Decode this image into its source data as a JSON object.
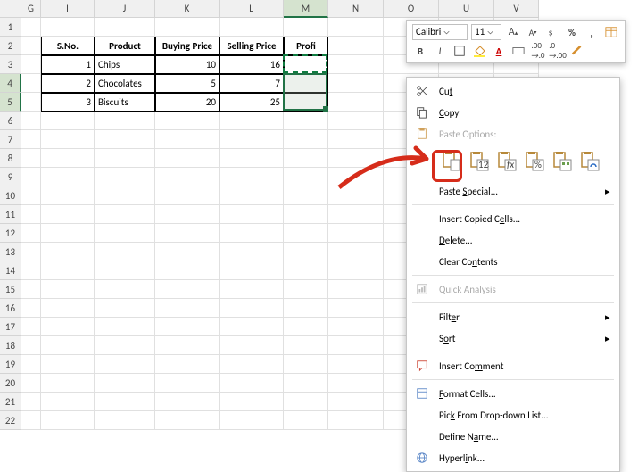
{
  "columns": [
    "G",
    "I",
    "J",
    "K",
    "L",
    "M",
    "N",
    "O",
    "U",
    "V"
  ],
  "sel_cols": [
    "M"
  ],
  "sel_rows": [
    4,
    5
  ],
  "row_count": 22,
  "table": {
    "headers": {
      "sno": "S.No.",
      "product": "Product",
      "bp": "Buying Price",
      "sp": "Selling Price",
      "profit": "Profi"
    },
    "rows": [
      {
        "sno": "1",
        "product": "Chips",
        "bp": "10",
        "sp": "16"
      },
      {
        "sno": "2",
        "product": "Chocolates",
        "bp": "5",
        "sp": "7"
      },
      {
        "sno": "3",
        "product": "Biscuits",
        "bp": "20",
        "sp": "25"
      }
    ]
  },
  "mini": {
    "font": "Calibri",
    "size": "11",
    "bold": "B",
    "italic": "I"
  },
  "ctx": {
    "cut": "Cut",
    "copy": "Copy",
    "paste_hdr": "Paste Options:",
    "paste_special": "Paste Special...",
    "insert": "Insert Copied Cells...",
    "delete": "Delete...",
    "clear": "Clear Contents",
    "quick": "Quick Analysis",
    "filter": "Filter",
    "sort": "Sort",
    "comment": "Insert Comment",
    "format": "Format Cells...",
    "pick": "Pick From Drop-down List...",
    "define": "Define Name...",
    "hyperlink": "Hyperlink..."
  },
  "paste_icons": [
    "paste",
    "paste-123",
    "paste-fx",
    "paste-fmt",
    "paste-pct",
    "paste-link"
  ]
}
